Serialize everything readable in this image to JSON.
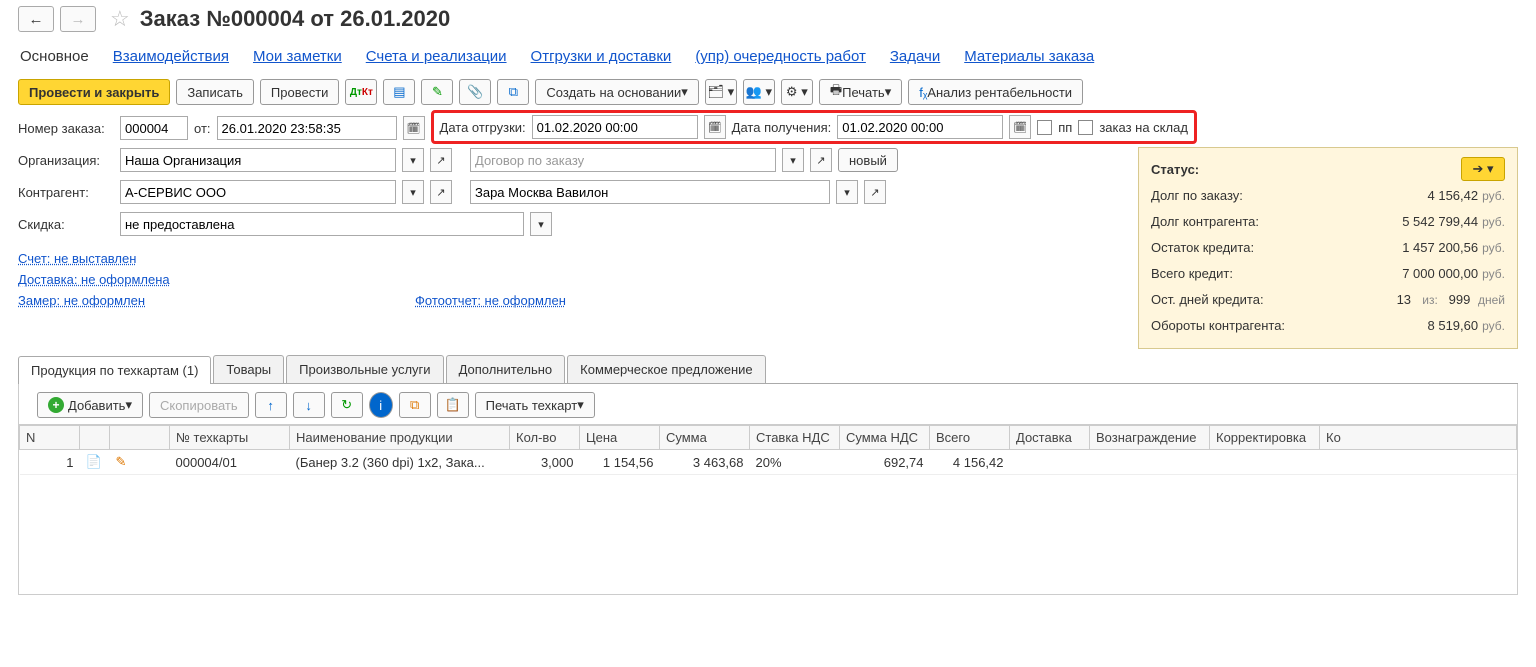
{
  "title": "Заказ №000004 от 26.01.2020",
  "nav_tabs": [
    "Основное",
    "Взаимодействия",
    "Мои заметки",
    "Счета и реализации",
    "Отгрузки и доставки",
    "(упр) очередность работ",
    "Задачи",
    "Материалы заказа"
  ],
  "toolbar": {
    "post_close": "Провести и закрыть",
    "save": "Записать",
    "post": "Провести",
    "create_based": "Создать на основании",
    "print": "Печать",
    "profit": "Анализ рентабельности"
  },
  "form": {
    "order_no_label": "Номер заказа:",
    "order_no": "000004",
    "from_label": "от:",
    "from_value": "26.01.2020 23:58:35",
    "ship_label": "Дата отгрузки:",
    "ship_value": "01.02.2020 00:00",
    "recv_label": "Дата получения:",
    "recv_value": "01.02.2020 00:00",
    "pp_label": "пп",
    "stock_label": "заказ на склад",
    "org_label": "Организация:",
    "org_value": "Наша Организация",
    "contract_placeholder": "Договор по заказу",
    "new_btn": "новый",
    "partner_label": "Контрагент:",
    "partner_value": "А-СЕРВИС ООО",
    "branch_value": "Зара Москва Вавилон",
    "discount_label": "Скидка:",
    "discount_value": "не предоставлена"
  },
  "links": {
    "invoice": "Счет: не выставлен",
    "delivery": "Доставка: не оформлена",
    "measure": "Замер: не оформлен",
    "photo": "Фотоотчет: не оформлен"
  },
  "status": {
    "header": "Статус:",
    "rows": [
      {
        "label": "Долг по заказу:",
        "value": "4 156,42",
        "unit": "руб."
      },
      {
        "label": "Долг контрагента:",
        "value": "5 542 799,44",
        "unit": "руб."
      },
      {
        "label": "Остаток кредита:",
        "value": "1 457 200,56",
        "unit": "руб."
      },
      {
        "label": "Всего кредит:",
        "value": "7 000 000,00",
        "unit": "руб."
      }
    ],
    "days_label": "Ост. дней кредита:",
    "days_left": "13",
    "days_of": "из:",
    "days_total": "999",
    "days_unit": "дней",
    "turnover_label": "Обороты контрагента:",
    "turnover_value": "8 519,60",
    "turnover_unit": "руб."
  },
  "prod_tabs": [
    "Продукция по техкартам (1)",
    "Товары",
    "Произвольные услуги",
    "Дополнительно",
    "Коммерческое предложение"
  ],
  "sub_toolbar": {
    "add": "Добавить",
    "copy": "Скопировать",
    "print_tc": "Печать техкарт"
  },
  "grid": {
    "columns": [
      "N",
      "",
      "",
      "№ техкарты",
      "Наименование продукции",
      "Кол-во",
      "Цена",
      "Сумма",
      "Ставка НДС",
      "Сумма НДС",
      "Всего",
      "Доставка",
      "Вознаграждение",
      "Корректировка",
      "Ко"
    ],
    "row": {
      "n": "1",
      "tc": "000004/01",
      "name": "(Банер 3.2 (360 dpi)  1x2, Зака...",
      "qty": "3,000",
      "price": "1 154,56",
      "sum": "3 463,68",
      "vat_rate": "20%",
      "vat_sum": "692,74",
      "total": "4 156,42"
    }
  }
}
